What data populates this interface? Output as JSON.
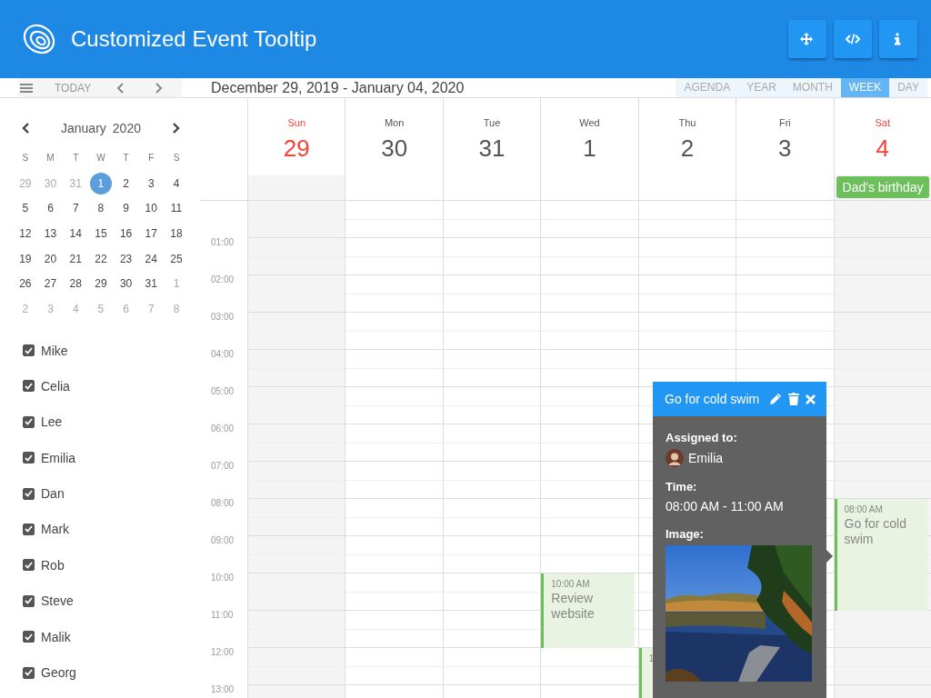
{
  "header": {
    "title": "Customized Event Tooltip",
    "buttons": [
      {
        "kind": "move"
      },
      {
        "kind": "code"
      },
      {
        "kind": "info"
      }
    ]
  },
  "toolbar": {
    "today": "TODAY",
    "range": "December 29, 2019 - January 04, 2020",
    "views": [
      {
        "label": "AGENDA",
        "selected": false
      },
      {
        "label": "YEAR",
        "selected": false
      },
      {
        "label": "MONTH",
        "selected": false
      },
      {
        "label": "WEEK",
        "selected": true
      },
      {
        "label": "DAY",
        "selected": false
      }
    ]
  },
  "mini_calendar": {
    "month": "January",
    "year": "2020",
    "weekdays": [
      "S",
      "M",
      "T",
      "W",
      "T",
      "F",
      "S"
    ],
    "weeks": [
      [
        {
          "day": "29",
          "muted": true,
          "selected": false
        },
        {
          "day": "30",
          "muted": true,
          "selected": false
        },
        {
          "day": "31",
          "muted": true,
          "selected": false
        },
        {
          "day": "1",
          "muted": false,
          "selected": true
        },
        {
          "day": "2",
          "muted": false,
          "selected": false
        },
        {
          "day": "3",
          "muted": false,
          "selected": false
        },
        {
          "day": "4",
          "muted": false,
          "selected": false
        }
      ],
      [
        {
          "day": "5",
          "muted": false,
          "selected": false
        },
        {
          "day": "6",
          "muted": false,
          "selected": false
        },
        {
          "day": "7",
          "muted": false,
          "selected": false
        },
        {
          "day": "8",
          "muted": false,
          "selected": false
        },
        {
          "day": "9",
          "muted": false,
          "selected": false
        },
        {
          "day": "10",
          "muted": false,
          "selected": false
        },
        {
          "day": "11",
          "muted": false,
          "selected": false
        }
      ],
      [
        {
          "day": "12",
          "muted": false,
          "selected": false
        },
        {
          "day": "13",
          "muted": false,
          "selected": false
        },
        {
          "day": "14",
          "muted": false,
          "selected": false
        },
        {
          "day": "15",
          "muted": false,
          "selected": false
        },
        {
          "day": "16",
          "muted": false,
          "selected": false
        },
        {
          "day": "17",
          "muted": false,
          "selected": false
        },
        {
          "day": "18",
          "muted": false,
          "selected": false
        }
      ],
      [
        {
          "day": "19",
          "muted": false,
          "selected": false
        },
        {
          "day": "20",
          "muted": false,
          "selected": false
        },
        {
          "day": "21",
          "muted": false,
          "selected": false
        },
        {
          "day": "22",
          "muted": false,
          "selected": false
        },
        {
          "day": "23",
          "muted": false,
          "selected": false
        },
        {
          "day": "24",
          "muted": false,
          "selected": false
        },
        {
          "day": "25",
          "muted": false,
          "selected": false
        }
      ],
      [
        {
          "day": "26",
          "muted": false,
          "selected": false
        },
        {
          "day": "27",
          "muted": false,
          "selected": false
        },
        {
          "day": "28",
          "muted": false,
          "selected": false
        },
        {
          "day": "29",
          "muted": false,
          "selected": false
        },
        {
          "day": "30",
          "muted": false,
          "selected": false
        },
        {
          "day": "31",
          "muted": false,
          "selected": false
        },
        {
          "day": "1",
          "muted": true,
          "selected": false
        }
      ],
      [
        {
          "day": "2",
          "muted": true,
          "selected": false
        },
        {
          "day": "3",
          "muted": true,
          "selected": false
        },
        {
          "day": "4",
          "muted": true,
          "selected": false
        },
        {
          "day": "5",
          "muted": true,
          "selected": false
        },
        {
          "day": "6",
          "muted": true,
          "selected": false
        },
        {
          "day": "7",
          "muted": true,
          "selected": false
        },
        {
          "day": "8",
          "muted": true,
          "selected": false
        }
      ]
    ]
  },
  "resources": [
    {
      "name": "Mike",
      "checked": true
    },
    {
      "name": "Celia",
      "checked": true
    },
    {
      "name": "Lee",
      "checked": true
    },
    {
      "name": "Emilia",
      "checked": true
    },
    {
      "name": "Dan",
      "checked": true
    },
    {
      "name": "Mark",
      "checked": true
    },
    {
      "name": "Rob",
      "checked": true
    },
    {
      "name": "Steve",
      "checked": true
    },
    {
      "name": "Malik",
      "checked": true
    },
    {
      "name": "Georg",
      "checked": true
    }
  ],
  "week": {
    "days": [
      {
        "name": "Sun",
        "date": "29",
        "weekend": true
      },
      {
        "name": "Mon",
        "date": "30",
        "weekend": false
      },
      {
        "name": "Tue",
        "date": "31",
        "weekend": false
      },
      {
        "name": "Wed",
        "date": "1",
        "weekend": false,
        "events": [
          {
            "time": "10:00 AM",
            "title": "Review website"
          }
        ]
      },
      {
        "name": "Thu",
        "date": "2",
        "weekend": false,
        "events": [
          {
            "time": "1"
          }
        ]
      },
      {
        "name": "Fri",
        "date": "3",
        "weekend": false
      },
      {
        "name": "Sat",
        "date": "4",
        "weekend": true,
        "all_day": [
          {
            "title": "Dad's birthday"
          }
        ],
        "events": [
          {
            "time": "08:00 AM",
            "title": "Go for cold swim"
          }
        ]
      }
    ],
    "time_labels": [
      "01:00",
      "02:00",
      "03:00",
      "04:00",
      "05:00",
      "06:00",
      "07:00",
      "08:00",
      "09:00",
      "10:00",
      "11:00",
      "12:00",
      "13:00"
    ]
  },
  "tooltip": {
    "title": "Go for cold swim",
    "sections": [
      {
        "kind": "person",
        "label": "Assigned to:",
        "value": "Emilia"
      },
      {
        "kind": "text",
        "label": "Time:",
        "value": "08:00 AM - 11:00 AM"
      },
      {
        "kind": "picture",
        "label": "Image:"
      }
    ]
  }
}
